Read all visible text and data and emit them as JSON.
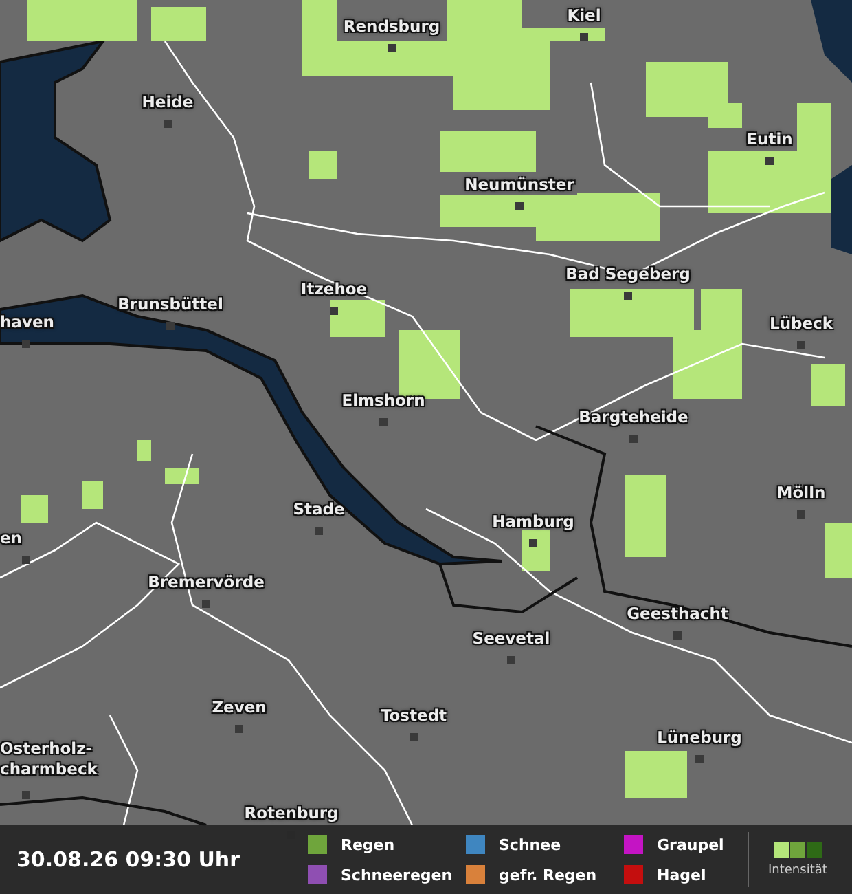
{
  "map": {
    "cities": [
      {
        "name": "Rendsburg"
      },
      {
        "name": "Kiel"
      },
      {
        "name": "Heide"
      },
      {
        "name": "Eutin"
      },
      {
        "name": "Neumünster"
      },
      {
        "name": "Bad Segeberg"
      },
      {
        "name": "Itzehoe"
      },
      {
        "name": "Brunsbüttel"
      },
      {
        "name": "haven"
      },
      {
        "name": "Lübeck"
      },
      {
        "name": "Elmshorn"
      },
      {
        "name": "Bargteheide"
      },
      {
        "name": "Mölln"
      },
      {
        "name": "Stade"
      },
      {
        "name": "Hamburg"
      },
      {
        "name": "en"
      },
      {
        "name": "Bremervörde"
      },
      {
        "name": "Geesthacht"
      },
      {
        "name": "Seevetal"
      },
      {
        "name": "Zeven"
      },
      {
        "name": "Tostedt"
      },
      {
        "name": "Lüneburg"
      },
      {
        "name": "Osterholz-\ncharmbeck"
      },
      {
        "name": "Rotenburg"
      }
    ]
  },
  "legend": {
    "timestamp": "30.08.26 09:30 Uhr",
    "items": [
      {
        "label": "Regen",
        "color": "#6fa53c"
      },
      {
        "label": "Schneeregen",
        "color": "#8f4fb2"
      },
      {
        "label": "Schnee",
        "color": "#3f86c0"
      },
      {
        "label": "gefr. Regen",
        "color": "#d9813b"
      },
      {
        "label": "Graupel",
        "color": "#c414c4"
      },
      {
        "label": "Hagel",
        "color": "#c40e0e"
      }
    ],
    "intensity": {
      "label": "Intensität",
      "scale": [
        {
          "color": "#b5e67a"
        },
        {
          "color": "#6fa53c"
        },
        {
          "color": "#2e6a16"
        }
      ]
    }
  }
}
